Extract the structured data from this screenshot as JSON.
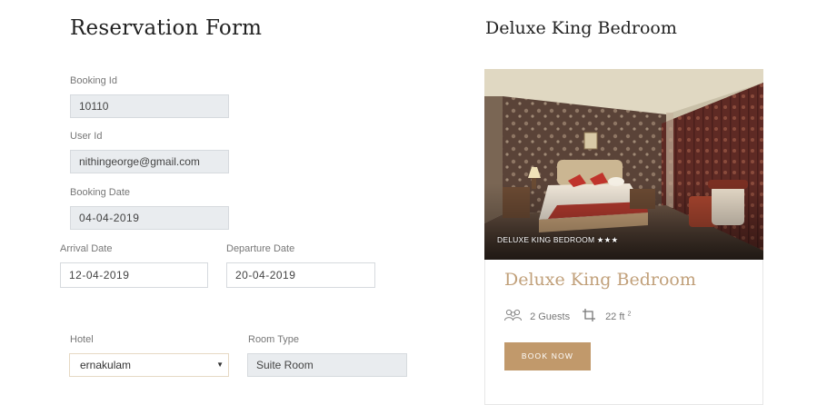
{
  "form": {
    "title": "Reservation Form",
    "booking_id": {
      "label": "Booking Id",
      "value": "10110"
    },
    "user_id": {
      "label": "User Id",
      "value": "nithingeorge@gmail.com"
    },
    "booking_date": {
      "label": "Booking Date",
      "value": "04-04-2019"
    },
    "arrival_date": {
      "label": "Arrival Date",
      "value": "12-04-2019"
    },
    "departure_date": {
      "label": "Departure Date",
      "value": "20-04-2019"
    },
    "hotel": {
      "label": "Hotel",
      "value": "ernakulam"
    },
    "room_type": {
      "label": "Room Type",
      "value": "Suite Room"
    }
  },
  "room": {
    "heading": "Deluxe King Bedroom",
    "photo_caption": "DELUXE KING BEDROOM ★★★",
    "name": "Deluxe King Bedroom",
    "guests": "2 Guests",
    "size": "22 ft",
    "size_unit_sup": "2",
    "book_label": "BOOK NOW"
  },
  "colors": {
    "accent": "#c1996b",
    "title_accent": "#c1a07a",
    "field_bg": "#e9ecef"
  },
  "icons": {
    "guests": "guests-icon",
    "area": "crop-icon",
    "dropdown": "caret-down-icon"
  }
}
